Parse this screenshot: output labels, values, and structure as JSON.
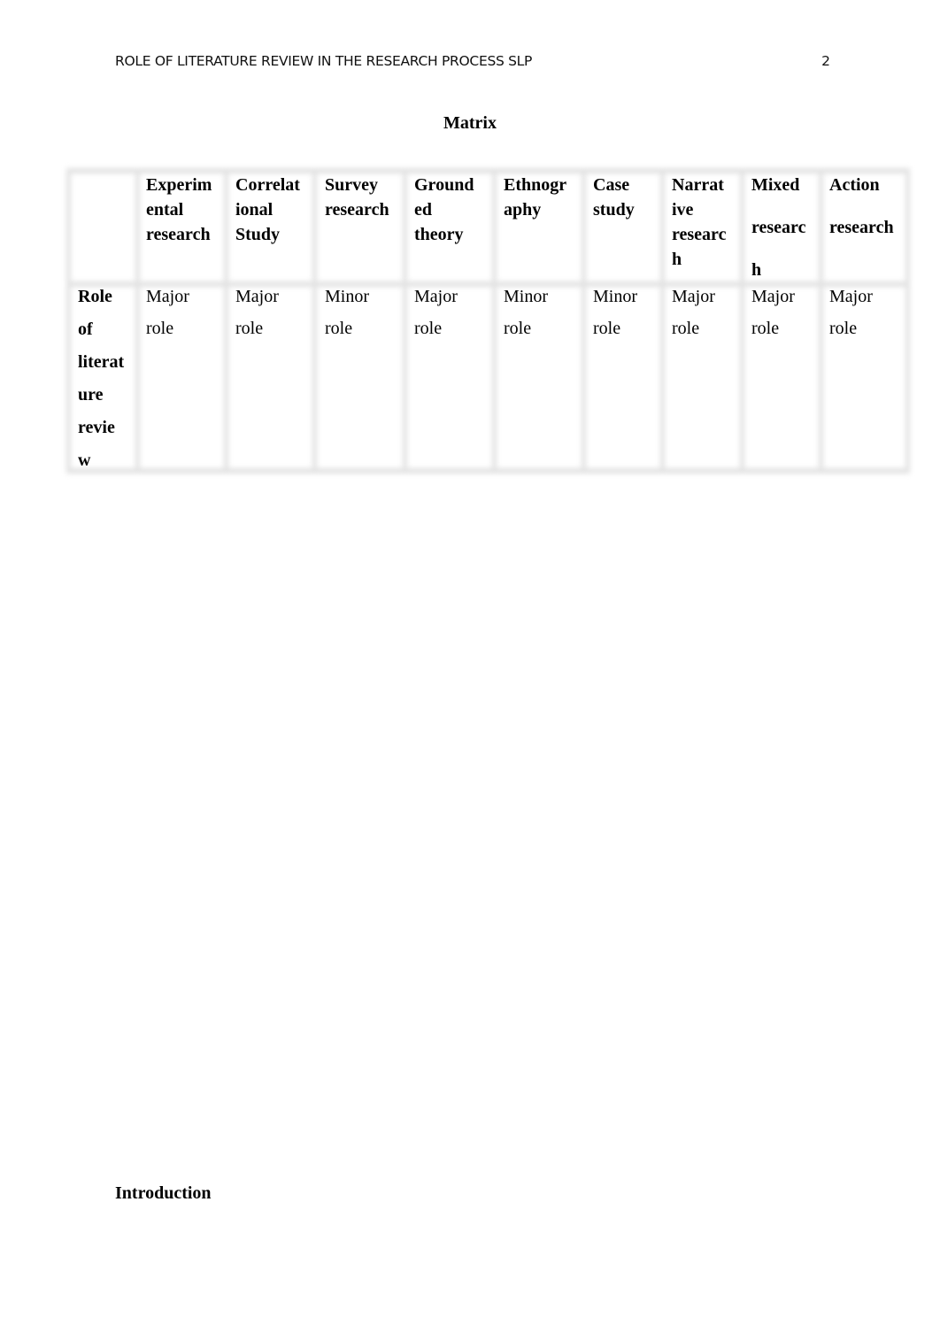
{
  "header": {
    "running_head": "ROLE OF LITERATURE REVIEW IN THE RESEARCH PROCESS SLP",
    "page_number": "2"
  },
  "matrix": {
    "title": "Matrix",
    "columns": [
      {
        "label": "Experimental research",
        "lines": [
          "Experim",
          "ental",
          "research"
        ]
      },
      {
        "label": "Correlational Study",
        "lines": [
          "Correlat",
          "ional",
          "Study"
        ]
      },
      {
        "label": "Survey research",
        "lines": [
          "Survey",
          "research"
        ]
      },
      {
        "label": "Grounded theory",
        "lines": [
          "Ground",
          "ed",
          "theory"
        ]
      },
      {
        "label": "Ethnography",
        "lines": [
          "Ethnogr",
          "aphy"
        ]
      },
      {
        "label": "Case study",
        "lines": [
          "Case",
          "study"
        ]
      },
      {
        "label": "Narrative research",
        "lines": [
          "Narrat",
          "ive",
          "researc",
          "h"
        ]
      },
      {
        "label": "Mixed research",
        "lines": [
          "Mixed",
          "researc",
          "h"
        ]
      },
      {
        "label": "Action research",
        "lines": [
          "Action",
          "research"
        ]
      }
    ],
    "row": {
      "label": "Role of literature review",
      "label_lines": [
        "Role",
        "of",
        "literat",
        "ure",
        "revie",
        "w"
      ],
      "values": [
        {
          "value": "Major role",
          "lines": [
            "Major",
            "role"
          ]
        },
        {
          "value": "Major role",
          "lines": [
            "Major",
            "role"
          ]
        },
        {
          "value": "Minor role",
          "lines": [
            "Minor",
            "role"
          ]
        },
        {
          "value": "Major role",
          "lines": [
            "Major",
            "role"
          ]
        },
        {
          "value": "Minor role",
          "lines": [
            "Minor",
            "role"
          ]
        },
        {
          "value": "Minor role",
          "lines": [
            "Minor",
            "role"
          ]
        },
        {
          "value": "Major role",
          "lines": [
            "Major",
            "role"
          ]
        },
        {
          "value": "Major role",
          "lines": [
            "Major",
            "role"
          ]
        },
        {
          "value": "Major role",
          "lines": [
            "Major",
            "role"
          ]
        }
      ]
    }
  },
  "sections": {
    "introduction_heading": "Introduction"
  }
}
